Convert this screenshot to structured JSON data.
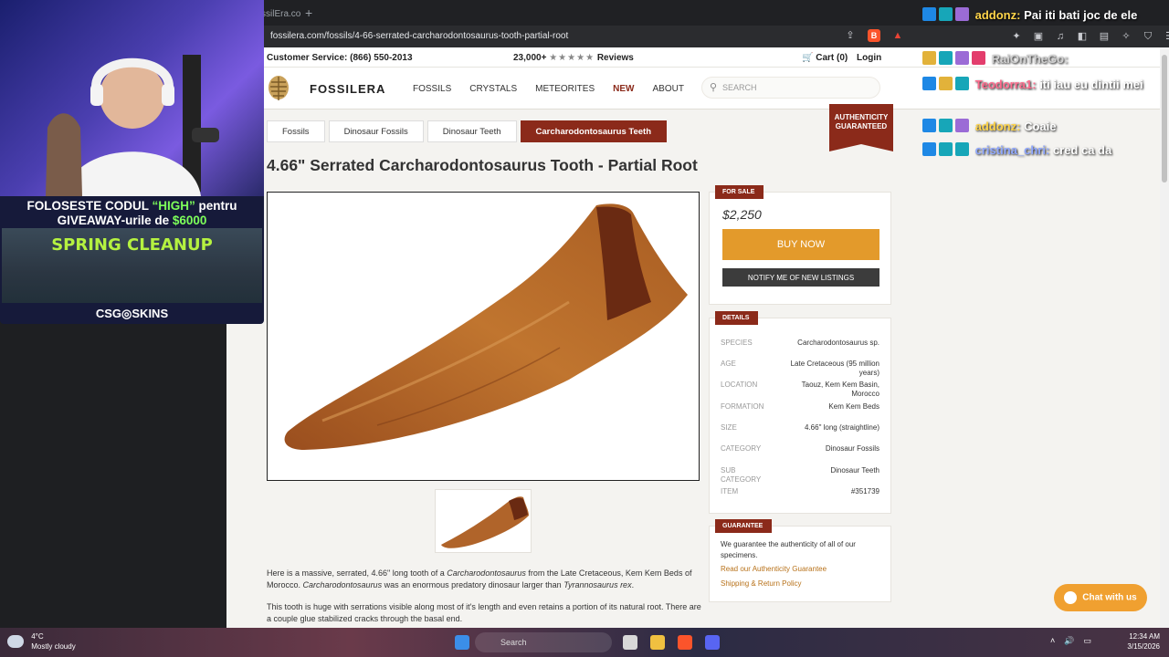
{
  "browser": {
    "tab_title": "ssilEra.co",
    "url": "fossilera.com/fossils/4-66-serrated-carcharodontosaurus-tooth-partial-root"
  },
  "site": {
    "customer_service": "Customer Service: (866) 550-2013",
    "reviews_count": "23,000+",
    "reviews_stars": "★★★★★",
    "reviews_label": "Reviews",
    "cart": "Cart (0)",
    "login": "Login",
    "brand": "FOSSILERA",
    "nav": [
      "FOSSILS",
      "CRYSTALS",
      "METEORITES",
      "NEW",
      "ABOUT"
    ],
    "search_placeholder": "SEARCH",
    "auth_badge": [
      "AUTHENTICITY",
      "GUARANTEED"
    ]
  },
  "breadcrumb": [
    "Fossils",
    "Dinosaur Fossils",
    "Dinosaur Teeth",
    "Carcharodontosaurus Teeth"
  ],
  "product": {
    "title": "4.66\" Serrated Carcharodontosaurus Tooth - Partial Root",
    "for_sale_tag": "FOR SALE",
    "price": "$2,250",
    "buy_label": "BUY NOW",
    "notify_label": "NOTIFY ME OF NEW LISTINGS",
    "details_tag": "DETAILS",
    "details": [
      {
        "k": "SPECIES",
        "v": "Carcharodontosaurus sp."
      },
      {
        "k": "AGE",
        "v": "Late Cretaceous (95 million years)"
      },
      {
        "k": "LOCATION",
        "v": "Taouz, Kem Kem Basin, Morocco"
      },
      {
        "k": "FORMATION",
        "v": "Kem Kem Beds"
      },
      {
        "k": "SIZE",
        "v": "4.66\" long (straightline)"
      },
      {
        "k": "CATEGORY",
        "v": "Dinosaur Fossils"
      },
      {
        "k": "SUB CATEGORY",
        "v": "Dinosaur Teeth"
      },
      {
        "k": "ITEM",
        "v": "#351739"
      }
    ],
    "guarantee_tag": "GUARANTEE",
    "guarantee_text": "We guarantee the authenticity of all of our specimens.",
    "guarantee_link1": "Read our Authenticity Guarantee",
    "guarantee_link2": "Shipping & Return Policy",
    "desc1_a": "Here is a massive, serrated, 4.66\" long tooth of a ",
    "desc1_b": "Carcharodontosaurus",
    "desc1_c": " from the Late Cretaceous, Kem Kem Beds of Morocco. ",
    "desc1_d": "Carcharodontosaurus",
    "desc1_e": " was an enormous predatory dinosaur larger than ",
    "desc1_f": "Tyrannosaurus rex",
    "desc1_g": ".",
    "desc2": "This tooth is huge with serrations visible along most of it's length and even retains a portion of its natural root. There are a couple glue stabilized cracks through the basal end.",
    "chat_label": "Chat with us"
  },
  "overlay": {
    "promo_line1_a": "FOLOSESTE CODUL ",
    "promo_line1_hl": "“HIGH”",
    "promo_line1_b": " pentru",
    "promo_line2_a": "GIVEAWAY-urile de ",
    "promo_line2_hl": "$6000",
    "game_title": "SPRING CLEANUP",
    "sponsor": "CSG◎SKINS"
  },
  "chat": [
    {
      "name": "addonz:",
      "text": "Pai iti bati joc de ele"
    },
    {
      "name": "RaiOnTheGo:",
      "text": ""
    },
    {
      "name": "Teodorra1:",
      "text": "iti iau eu dintii mei"
    },
    {
      "name": "addonz:",
      "text": "Coaie"
    },
    {
      "name": "cristina_chri:",
      "text": "cred ca da"
    }
  ],
  "taskbar": {
    "temp": "4°C",
    "weather": "Mostly cloudy",
    "search": "Search",
    "time": "12:34 AM",
    "date": "3/15/2026"
  },
  "colors": {
    "brand_red": "#8b2a1a",
    "buy_orange": "#e39a2b",
    "chat_orange": "#f0a030"
  }
}
